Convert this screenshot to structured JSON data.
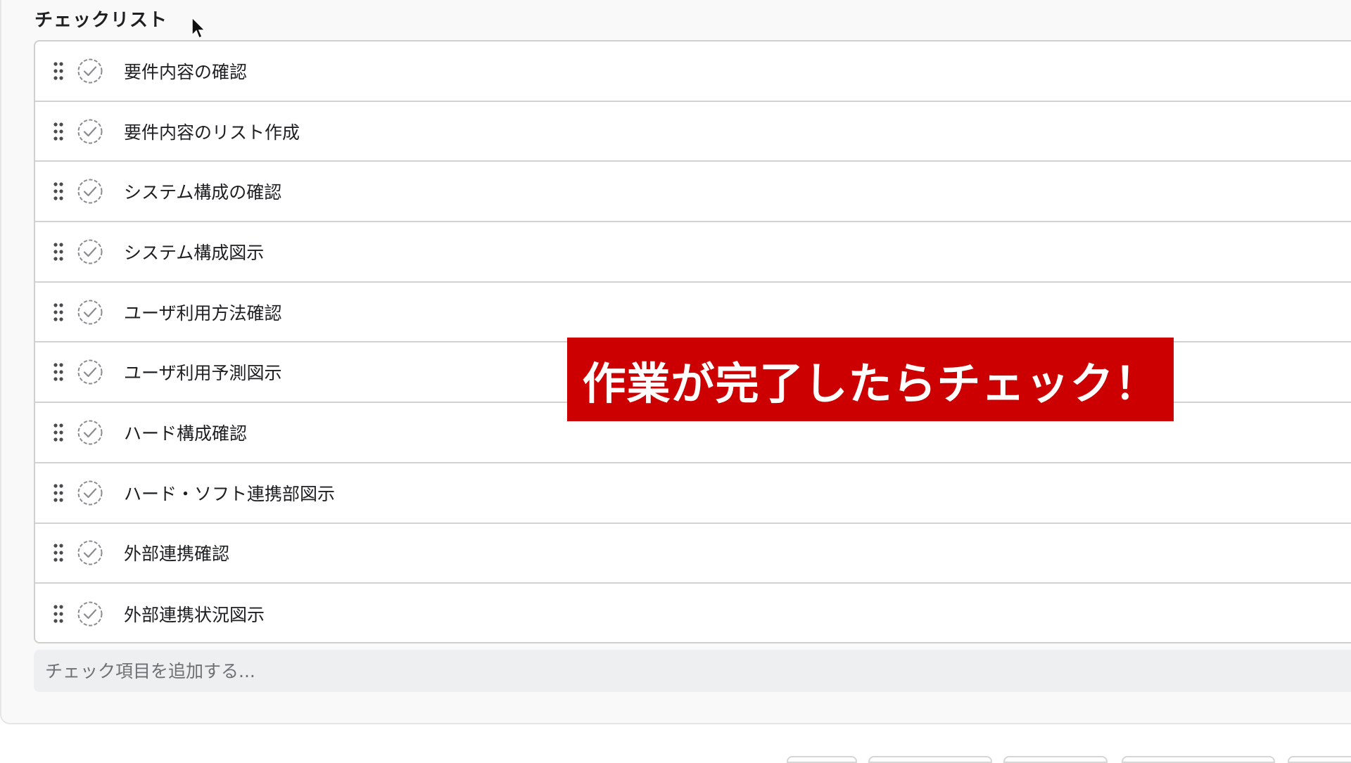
{
  "checklist": {
    "title": "チェックリスト",
    "items": [
      {
        "label": "要件内容の確認"
      },
      {
        "label": "要件内容のリスト作成"
      },
      {
        "label": "システム構成の確認"
      },
      {
        "label": "システム構成図示"
      },
      {
        "label": "ユーザ利用方法確認"
      },
      {
        "label": "ユーザ利用予測図示"
      },
      {
        "label": "ハード構成確認"
      },
      {
        "label": "ハード・ソフト連携部図示"
      },
      {
        "label": "外部連携確認"
      },
      {
        "label": "外部連携状況図示"
      }
    ],
    "add_placeholder": "チェック項目を追加する..."
  },
  "overlay": {
    "caption": "作業が完了したらチェック！",
    "background_color": "#cc0000",
    "text_color": "#ffffff"
  },
  "icons": {
    "drag": "drag-handle-icon",
    "check": "check-circle-icon",
    "cursor": "mouse-cursor-icon"
  }
}
